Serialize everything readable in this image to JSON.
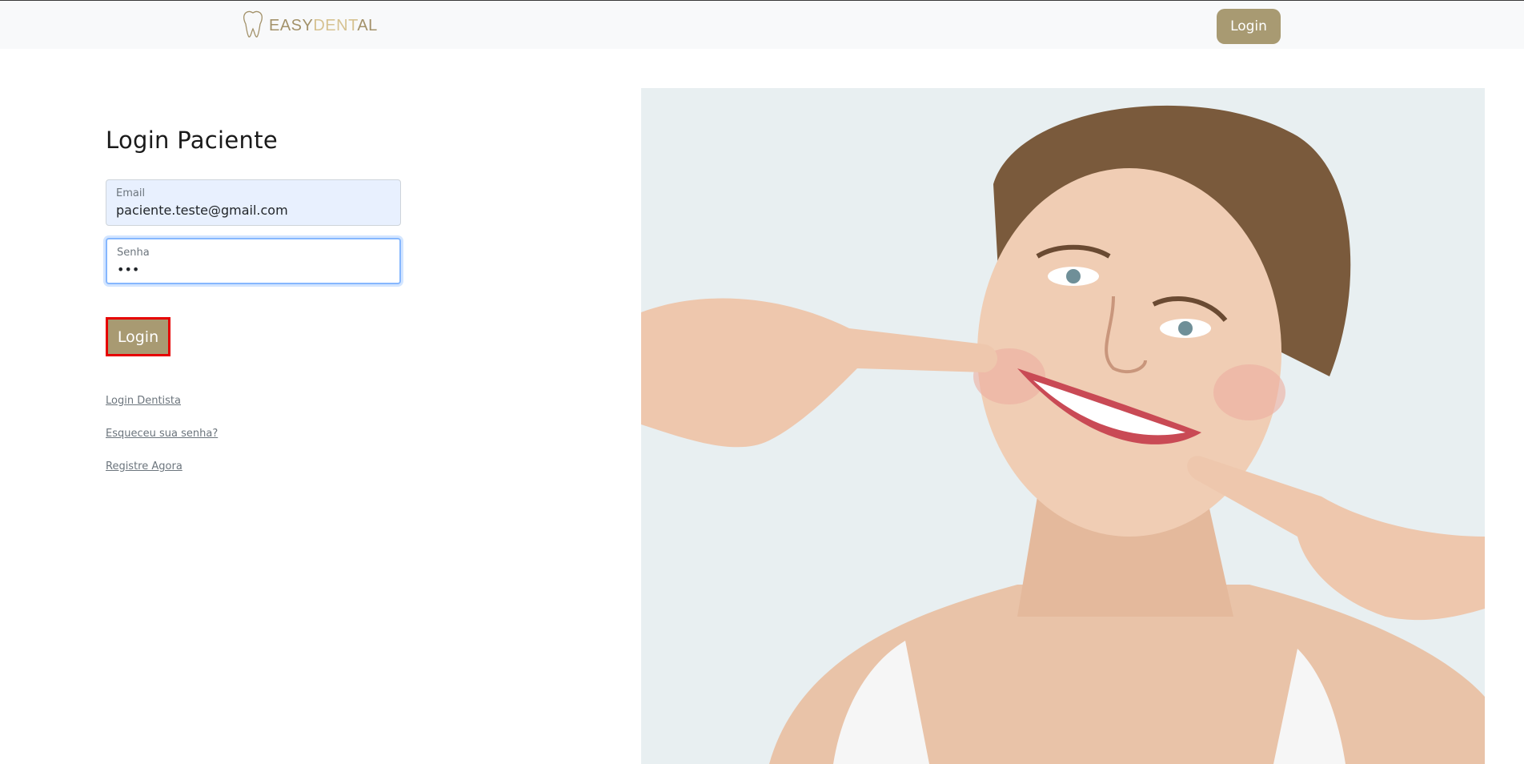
{
  "navbar": {
    "logo_part1": "EASY",
    "logo_part2": "DENT",
    "logo_part3": "AL",
    "login_label": "Login"
  },
  "main": {
    "title": "Login Paciente",
    "email": {
      "label": "Email",
      "value": "paciente.teste@gmail.com"
    },
    "senha": {
      "label": "Senha",
      "value": "•••"
    },
    "login_button": "Login",
    "links": [
      "Login Dentista",
      "Esqueceu sua senha?",
      "Registre Agora"
    ]
  },
  "colors": {
    "accent": "#a89a72",
    "highlight_border": "#e60000",
    "navbar_bg": "#f8f9fa"
  },
  "icons": {
    "logo": "tooth-icon"
  }
}
